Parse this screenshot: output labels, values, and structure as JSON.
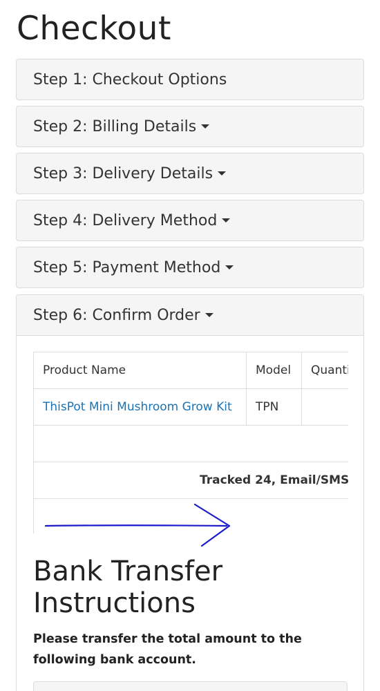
{
  "page": {
    "title": "Checkout"
  },
  "steps": [
    {
      "label": "Step 1: Checkout Options",
      "has_caret": false
    },
    {
      "label": "Step 2: Billing Details",
      "has_caret": true
    },
    {
      "label": "Step 3: Delivery Details",
      "has_caret": true
    },
    {
      "label": "Step 4: Delivery Method",
      "has_caret": true
    },
    {
      "label": "Step 5: Payment Method",
      "has_caret": true
    },
    {
      "label": "Step 6: Confirm Order",
      "has_caret": true
    }
  ],
  "order_table": {
    "headers": [
      "Product Name",
      "Model",
      "Quantity"
    ],
    "rows": [
      {
        "product": "ThisPot Mini Mushroom Grow Kit",
        "model": "TPN",
        "quantity": ""
      }
    ],
    "totals": [
      {
        "label": ""
      },
      {
        "label": "Tracked 24, Email/SMS"
      },
      {
        "label": ""
      }
    ]
  },
  "annotation": {
    "arrow_color": "#1a1acc"
  },
  "bank_transfer": {
    "title_line1": "Bank Transfer",
    "title_line2": "Instructions",
    "text": "Please transfer the total amount to the following bank account."
  },
  "colors": {
    "link": "#1a73b5",
    "panel_bg": "#f5f5f5",
    "border": "#dcdcdc"
  }
}
